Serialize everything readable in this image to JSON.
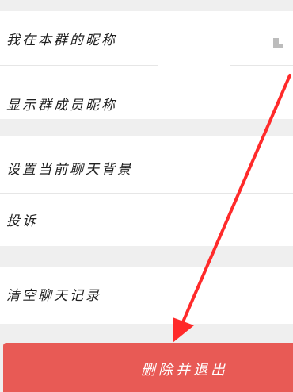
{
  "settings": {
    "items": [
      {
        "label": "我在本群的昵称"
      },
      {
        "label": "显示群成员昵称"
      },
      {
        "label": "设置当前聊天背景"
      },
      {
        "label": "投诉"
      },
      {
        "label": "清空聊天记录"
      }
    ],
    "nickname_value_icon": "image-placeholder-icon"
  },
  "actions": {
    "exit_label": "删除并退出"
  },
  "colors": {
    "background": "#efefef",
    "row_background": "#ffffff",
    "exit_button": "#e85a55",
    "annotation_arrow": "#ff2a2a"
  },
  "annotation": {
    "icon": "red-arrow-icon"
  }
}
